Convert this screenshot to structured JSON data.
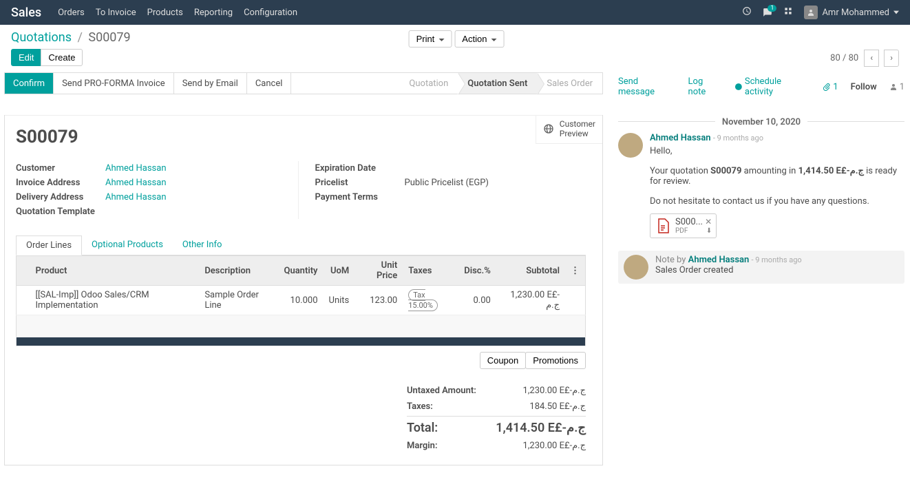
{
  "nav": {
    "brand": "Sales",
    "menu": [
      "Orders",
      "To Invoice",
      "Products",
      "Reporting",
      "Configuration"
    ],
    "chat_badge": "1",
    "user": "Amr Mohammed"
  },
  "breadcrumb": {
    "root": "Quotations",
    "current": "S00079"
  },
  "buttons": {
    "edit": "Edit",
    "create": "Create",
    "print": "Print",
    "action": "Action"
  },
  "pager": {
    "text": "80 / 80"
  },
  "statusbar": {
    "confirm": "Confirm",
    "proforma": "Send PRO-FORMA Invoice",
    "send_email": "Send by Email",
    "cancel": "Cancel",
    "stages": [
      "Quotation",
      "Quotation Sent",
      "Sales Order"
    ],
    "active_stage": 1
  },
  "preview_label": "Customer\nPreview",
  "doc": {
    "name": "S00079"
  },
  "fields": {
    "customer_label": "Customer",
    "customer_value": "Ahmed Hassan",
    "invoice_label": "Invoice Address",
    "invoice_value": "Ahmed Hassan",
    "delivery_label": "Delivery Address",
    "delivery_value": "Ahmed Hassan",
    "template_label": "Quotation Template",
    "expiration_label": "Expiration Date",
    "pricelist_label": "Pricelist",
    "pricelist_value": "Public Pricelist (EGP)",
    "terms_label": "Payment Terms"
  },
  "tabs": [
    "Order Lines",
    "Optional Products",
    "Other Info"
  ],
  "line_headers": {
    "product": "Product",
    "description": "Description",
    "qty": "Quantity",
    "uom": "UoM",
    "price": "Unit Price",
    "taxes": "Taxes",
    "disc": "Disc.%",
    "subtotal": "Subtotal"
  },
  "lines": [
    {
      "product": "[[SAL-Imp]] Odoo Sales/CRM Implementation",
      "description": "Sample Order Line",
      "qty": "10.000",
      "uom": "Units",
      "price": "123.00",
      "tax": "Tax 15.00%",
      "disc": "0.00",
      "subtotal": "1,230.00 E£-ج.م"
    }
  ],
  "footer_btns": {
    "coupon": "Coupon",
    "promo": "Promotions"
  },
  "totals": {
    "untaxed_label": "Untaxed Amount:",
    "untaxed": "1,230.00 E£-ج.م",
    "taxes_label": "Taxes:",
    "taxes": "184.50 E£-ج.م",
    "total_label": "Total:",
    "total": "1,414.50 E£-ج.م",
    "margin_label": "Margin:",
    "margin": "1,230.00 E£-ج.م"
  },
  "chatter": {
    "send": "Send message",
    "log": "Log note",
    "schedule": "Schedule activity",
    "attach_count": "1",
    "follow": "Follow",
    "follower_count": "1",
    "date": "November 10, 2020",
    "msg_author": "Ahmed Hassan",
    "msg_time": "- 9 months ago",
    "greeting": "Hello,",
    "line1a": "Your quotation ",
    "line1b": "S00079",
    "line1c": " amounting in ",
    "line1d": "1,414.50 E£-ج.م",
    "line1e": " is ready for review.",
    "line2": "Do not hesitate to contact us if you have any questions.",
    "attachment_name": "S000...",
    "attachment_type": "PDF",
    "note_prefix": "Note by ",
    "note_author": "Ahmed Hassan",
    "note_time": "- 9 months ago",
    "note_body": "Sales Order created"
  }
}
